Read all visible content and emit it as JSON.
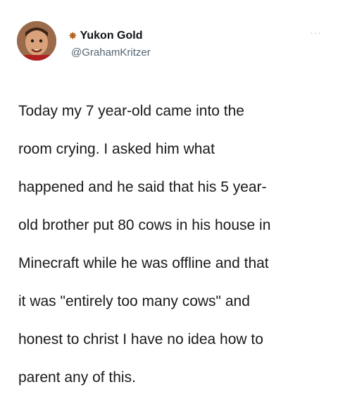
{
  "author": {
    "display_name": "Yukon Gold",
    "name_icon": "maple-leaf-star-icon",
    "handle": "@GrahamKritzer"
  },
  "menu": {
    "more_icon": "more-options-icon",
    "glyph": "···"
  },
  "tweet": {
    "lines": [
      "Today my 7 year-old came into the",
      "room crying. I asked him what",
      "happened and he said that his 5 year-",
      "old brother put 80 cows in his house in",
      "Minecraft while he was offline and that",
      "it was \"entirely too many cows\" and",
      "honest to christ I have no idea how to",
      "parent any of this."
    ]
  }
}
